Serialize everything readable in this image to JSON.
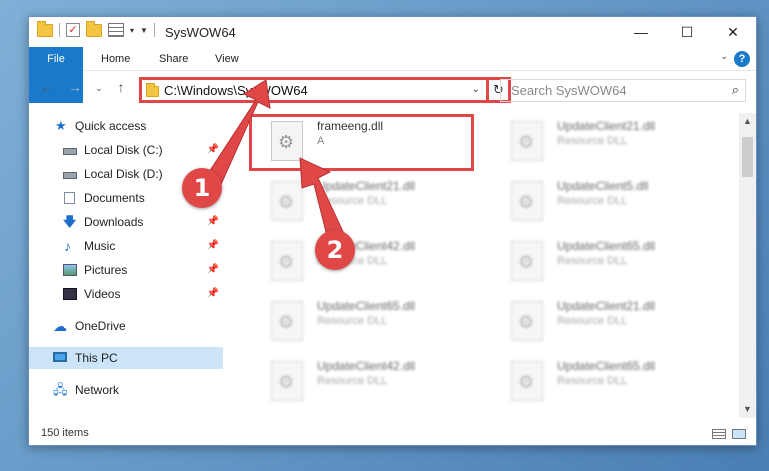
{
  "window": {
    "title": "SysWOW64"
  },
  "ribbon": {
    "tabs": [
      "File",
      "Home",
      "Share",
      "View"
    ]
  },
  "address": {
    "path": "C:\\Windows\\SysWOW64"
  },
  "search": {
    "placeholder": "Search SysWOW64"
  },
  "sidebar": {
    "items": [
      {
        "label": "Quick access",
        "icon": "star-icon"
      },
      {
        "label": "Local Disk (C:)",
        "icon": "disk-icon"
      },
      {
        "label": "Local Disk (D:)",
        "icon": "disk-icon"
      },
      {
        "label": "Documents",
        "icon": "documents-icon"
      },
      {
        "label": "Downloads",
        "icon": "download-icon"
      },
      {
        "label": "Music",
        "icon": "music-icon"
      },
      {
        "label": "Pictures",
        "icon": "pictures-icon"
      },
      {
        "label": "Videos",
        "icon": "videos-icon"
      },
      {
        "label": "OneDrive",
        "icon": "cloud-icon"
      },
      {
        "label": "This PC",
        "icon": "pc-icon"
      },
      {
        "label": "Network",
        "icon": "network-icon"
      }
    ]
  },
  "files": [
    {
      "name": "frameeng.dll",
      "type": "A"
    },
    {
      "name": "UpdateClient21.dll",
      "type": "Resource DLL"
    },
    {
      "name": "UpdateClient21.dll",
      "type": "Resource DLL"
    },
    {
      "name": "UpdateClient5.dll",
      "type": "Resource DLL"
    },
    {
      "name": "UpdateClient42.dll",
      "type": "Resource DLL"
    },
    {
      "name": "UpdateClient65.dll",
      "type": "Resource DLL"
    },
    {
      "name": "UpdateClient65.dll",
      "type": "Resource DLL"
    },
    {
      "name": "UpdateClient21.dll",
      "type": "Resource DLL"
    },
    {
      "name": "UpdateClient42.dll",
      "type": "Resource DLL"
    },
    {
      "name": "UpdateClient65.dll",
      "type": "Resource DLL"
    }
  ],
  "status": {
    "count": "150 items"
  },
  "annotations": {
    "step1": "1",
    "step2": "2",
    "color": "#e04848"
  }
}
